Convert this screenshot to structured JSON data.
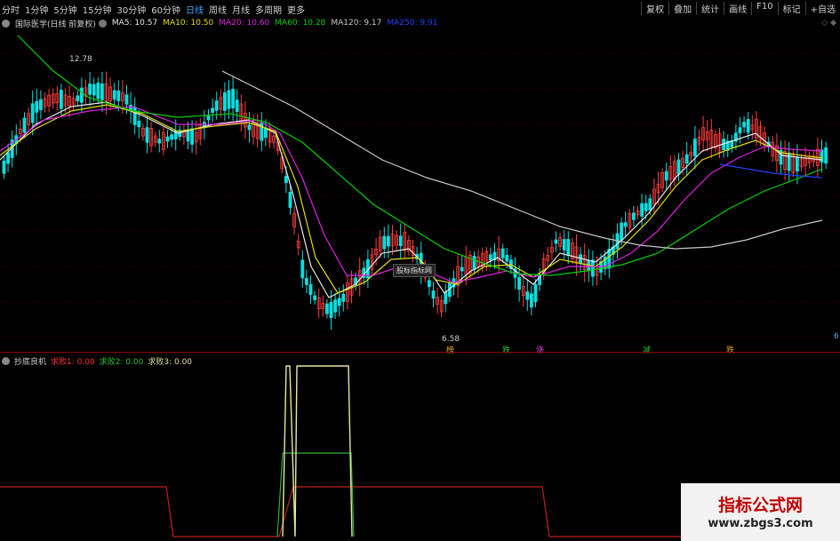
{
  "toolbar": {
    "periods": [
      "分时",
      "1分钟",
      "5分钟",
      "15分钟",
      "30分钟",
      "60分钟",
      "日线",
      "周线",
      "月线",
      "多周期",
      "更多"
    ],
    "active_period": "日线",
    "right_buttons": [
      "复权",
      "叠加",
      "统计",
      "画线",
      "F10",
      "标记",
      "+自选"
    ]
  },
  "chart_header": {
    "title": "国际医学(日线 前复权)",
    "ma5": "MA5: 10.57",
    "ma10": "MA10: 10.50",
    "ma20": "MA20: 10.60",
    "ma60": "MA60: 10.28",
    "ma120": "MA120: 9.17",
    "ma250": "MA250: 9.91"
  },
  "colors": {
    "up": "#ff3c3c",
    "down": "#00e0e0",
    "ma5": "#e8e8e8",
    "ma10": "#e0e000",
    "ma20": "#e020e0",
    "ma60": "#00d000",
    "ma120": "#c8c8c8",
    "ma250": "#2040ff"
  },
  "price_labels": {
    "high": "12.78",
    "low": "6.58"
  },
  "event_markers": [
    "榜",
    "跌",
    "涨",
    "减",
    "跌"
  ],
  "right_edge_label": "6",
  "popup_label": "股标指标网",
  "sub_indicator": {
    "name": "抄底良机",
    "q1": "求败1: 0.00",
    "q2": "求败2: 0.00",
    "q3": "求败3: 0.00"
  },
  "top_icons": "◇ ◆",
  "watermark": {
    "title": "指标公式网",
    "url": "www.zbgs3.com"
  }
}
